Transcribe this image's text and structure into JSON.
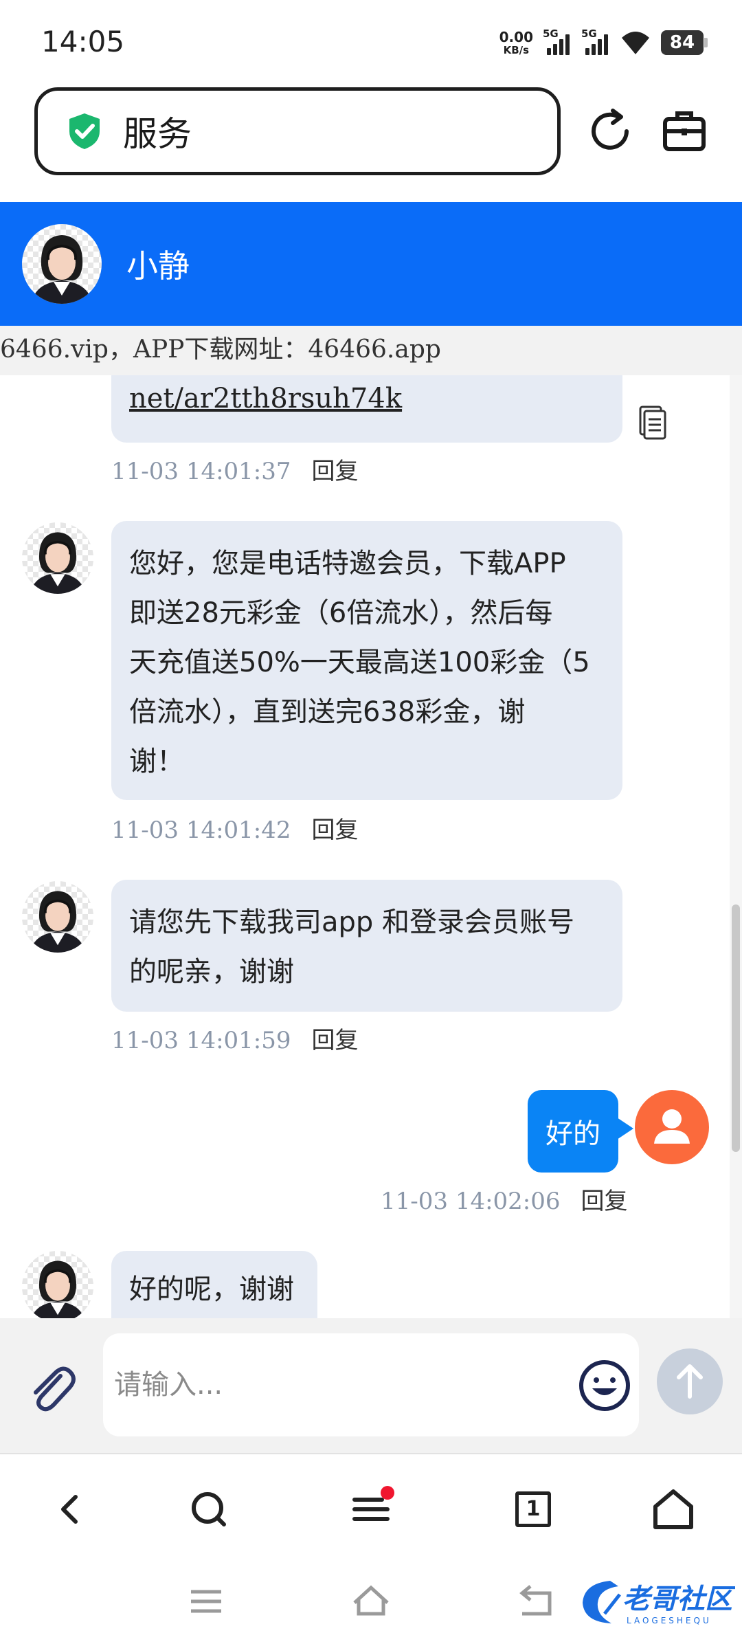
{
  "status_bar": {
    "time": "14:05",
    "net_speed_value": "0.00",
    "net_speed_unit": "KB/s",
    "sim1": "5G",
    "sim2": "5G",
    "battery": "84"
  },
  "browser": {
    "site_title": "服务",
    "icons": [
      "shield-check-icon",
      "refresh-icon",
      "toolbox-icon"
    ]
  },
  "chat_header": {
    "agent_name": "小静",
    "header_color": "#0a6cf8"
  },
  "notice": {
    "text": "6466.vip，APP下载网址：46466.app"
  },
  "messages": [
    {
      "sender": "agent",
      "text": "net/ar2tth8rsuh74k",
      "time": "11-03 14:01:37",
      "reply": "回复"
    },
    {
      "sender": "agent",
      "lines": [
        "您好，您是电话特邀会员，下载APP",
        "即送28元彩金（6倍流水），然后每",
        "天充值送50%一天最高送100彩金（5",
        "倍流水），直到送完638彩金，谢",
        "谢！"
      ],
      "time": "11-03 14:01:42",
      "reply": "回复"
    },
    {
      "sender": "agent",
      "lines": [
        "请您先下载我司app 和登录会员账号",
        "的呢亲，谢谢"
      ],
      "time": "11-03 14:01:59",
      "reply": "回复"
    },
    {
      "sender": "user",
      "text": "好的",
      "time": "11-03 14:02:06",
      "reply": "回复"
    },
    {
      "sender": "agent",
      "text": "好的呢，谢谢"
    }
  ],
  "input": {
    "placeholder": "请输入..."
  },
  "bottom_nav": {
    "tab_count": "1",
    "icons": [
      "back-icon",
      "search-icon",
      "menu-icon",
      "tabs-icon",
      "home-icon"
    ]
  },
  "colors": {
    "accent": "#0a6cf8",
    "user_bubble": "#0a84f5",
    "agent_bubble": "#e6ebf4",
    "user_avatar": "#fb6a3c",
    "notification_dot": "#f0162f"
  },
  "watermark": {
    "text": "老哥社区",
    "subtext": "LAOGESHEQU"
  }
}
